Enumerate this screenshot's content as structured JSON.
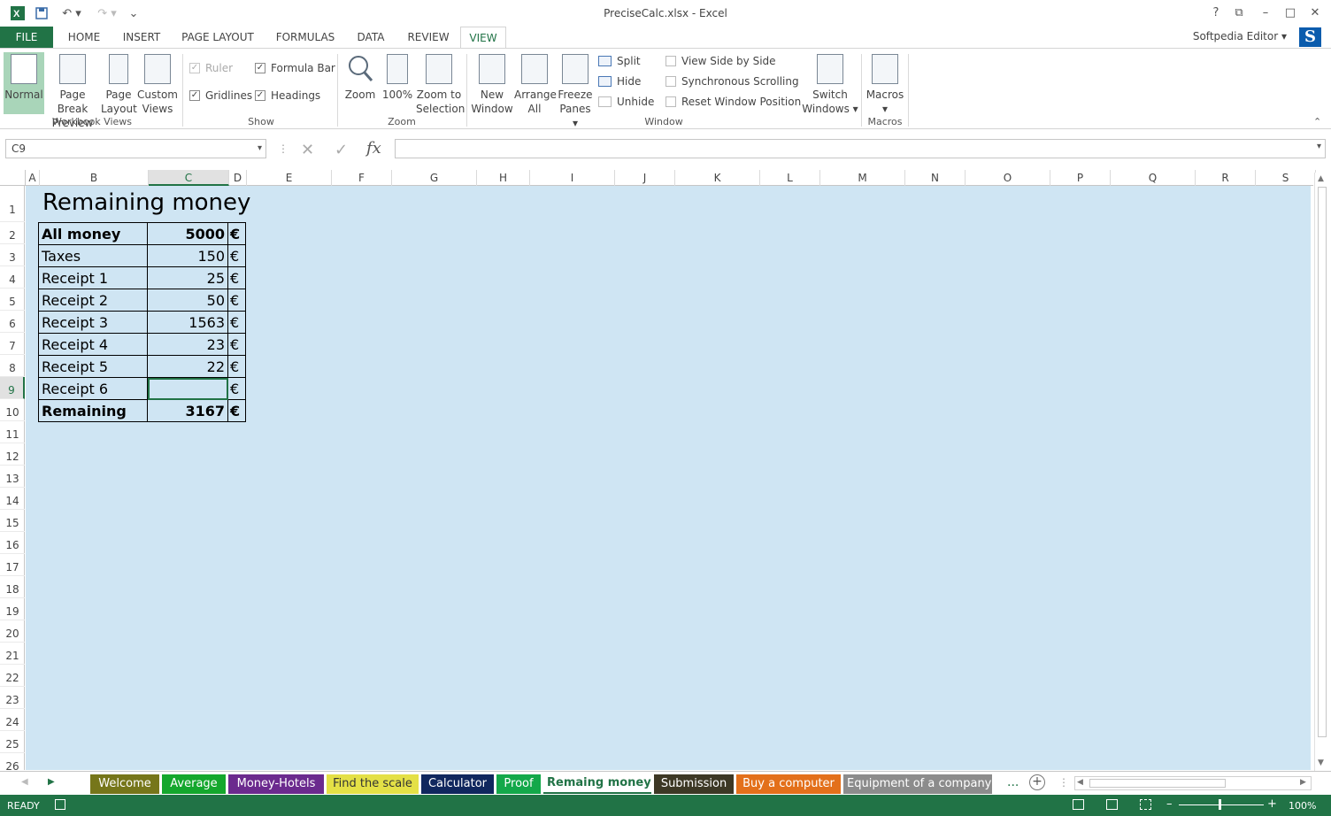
{
  "window": {
    "title": "PreciseCalc.xlsx - Excel",
    "user": "Softpedia Editor",
    "user_initial": "S"
  },
  "menu_tabs": [
    "FILE",
    "HOME",
    "INSERT",
    "PAGE LAYOUT",
    "FORMULAS",
    "DATA",
    "REVIEW",
    "VIEW"
  ],
  "active_menu_tab": "VIEW",
  "ribbon": {
    "workbook_views": {
      "label": "Workbook Views",
      "normal": "Normal",
      "page_break_1": "Page Break",
      "page_break_2": "Preview",
      "page_layout_1": "Page",
      "page_layout_2": "Layout",
      "custom_1": "Custom",
      "custom_2": "Views"
    },
    "show": {
      "label": "Show",
      "ruler": "Ruler",
      "gridlines": "Gridlines",
      "formula_bar": "Formula Bar",
      "headings": "Headings"
    },
    "zoom": {
      "label": "Zoom",
      "zoom": "Zoom",
      "hundred": "100%",
      "zoom_sel_1": "Zoom to",
      "zoom_sel_2": "Selection"
    },
    "window": {
      "label": "Window",
      "new_1": "New",
      "new_2": "Window",
      "arrange_1": "Arrange",
      "arrange_2": "All",
      "freeze_1": "Freeze",
      "freeze_2": "Panes",
      "split": "Split",
      "hide": "Hide",
      "unhide": "Unhide",
      "side_by_side": "View Side by Side",
      "sync_scroll": "Synchronous Scrolling",
      "reset_pos": "Reset Window Position",
      "switch_1": "Switch",
      "switch_2": "Windows"
    },
    "macros": {
      "label": "Macros",
      "macros": "Macros"
    }
  },
  "formula_bar": {
    "name_box": "C9",
    "fx": "fx",
    "value": ""
  },
  "columns": [
    "A",
    "B",
    "C",
    "D",
    "E",
    "F",
    "G",
    "H",
    "I",
    "J",
    "K",
    "L",
    "M",
    "N",
    "O",
    "P",
    "Q",
    "R",
    "S"
  ],
  "selected_column": "C",
  "rows": [
    "1",
    "2",
    "3",
    "4",
    "5",
    "6",
    "7",
    "8",
    "9",
    "10",
    "11",
    "12",
    "13",
    "14",
    "15",
    "16",
    "17",
    "18",
    "19",
    "20",
    "21",
    "22",
    "23",
    "24",
    "25",
    "26"
  ],
  "selected_row": "9",
  "sheet": {
    "title": "Remaining money",
    "table": [
      {
        "label": "All money",
        "value": "5000",
        "currency": "€",
        "bold": true
      },
      {
        "label": "Taxes",
        "value": "150",
        "currency": "€",
        "bold": false
      },
      {
        "label": "Receipt 1",
        "value": "25",
        "currency": "€",
        "bold": false
      },
      {
        "label": "Receipt 2",
        "value": "50",
        "currency": "€",
        "bold": false
      },
      {
        "label": "Receipt 3",
        "value": "1563",
        "currency": "€",
        "bold": false
      },
      {
        "label": "Receipt 4",
        "value": "23",
        "currency": "€",
        "bold": false
      },
      {
        "label": "Receipt 5",
        "value": "22",
        "currency": "€",
        "bold": false
      },
      {
        "label": "Receipt 6",
        "value": "",
        "currency": "€",
        "bold": false
      },
      {
        "label": "Remaining",
        "value": "3167",
        "currency": "€",
        "bold": true
      }
    ]
  },
  "sheet_tabs": [
    {
      "name": "Welcome",
      "color": "#76761a"
    },
    {
      "name": "Average",
      "color": "#14a72d"
    },
    {
      "name": "Money-Hotels",
      "color": "#6b2a8e"
    },
    {
      "name": "Find the scale",
      "color": "#e4e046"
    },
    {
      "name": "Calculator",
      "color": "#10275e"
    },
    {
      "name": "Proof",
      "color": "#13a84a"
    },
    {
      "name": "Remaing money",
      "color": "#ffffff"
    },
    {
      "name": "Submission",
      "color": "#3d3825"
    },
    {
      "name": "Buy a computer",
      "color": "#e3701b"
    },
    {
      "name": "Equipment of a company",
      "color": "#8c8c8c"
    }
  ],
  "active_sheet_tab": "Remaing money",
  "status": {
    "ready": "READY",
    "zoom": "100%"
  },
  "colors": {
    "accent": "#217346",
    "sheet_bg": "#cfe5f3"
  }
}
